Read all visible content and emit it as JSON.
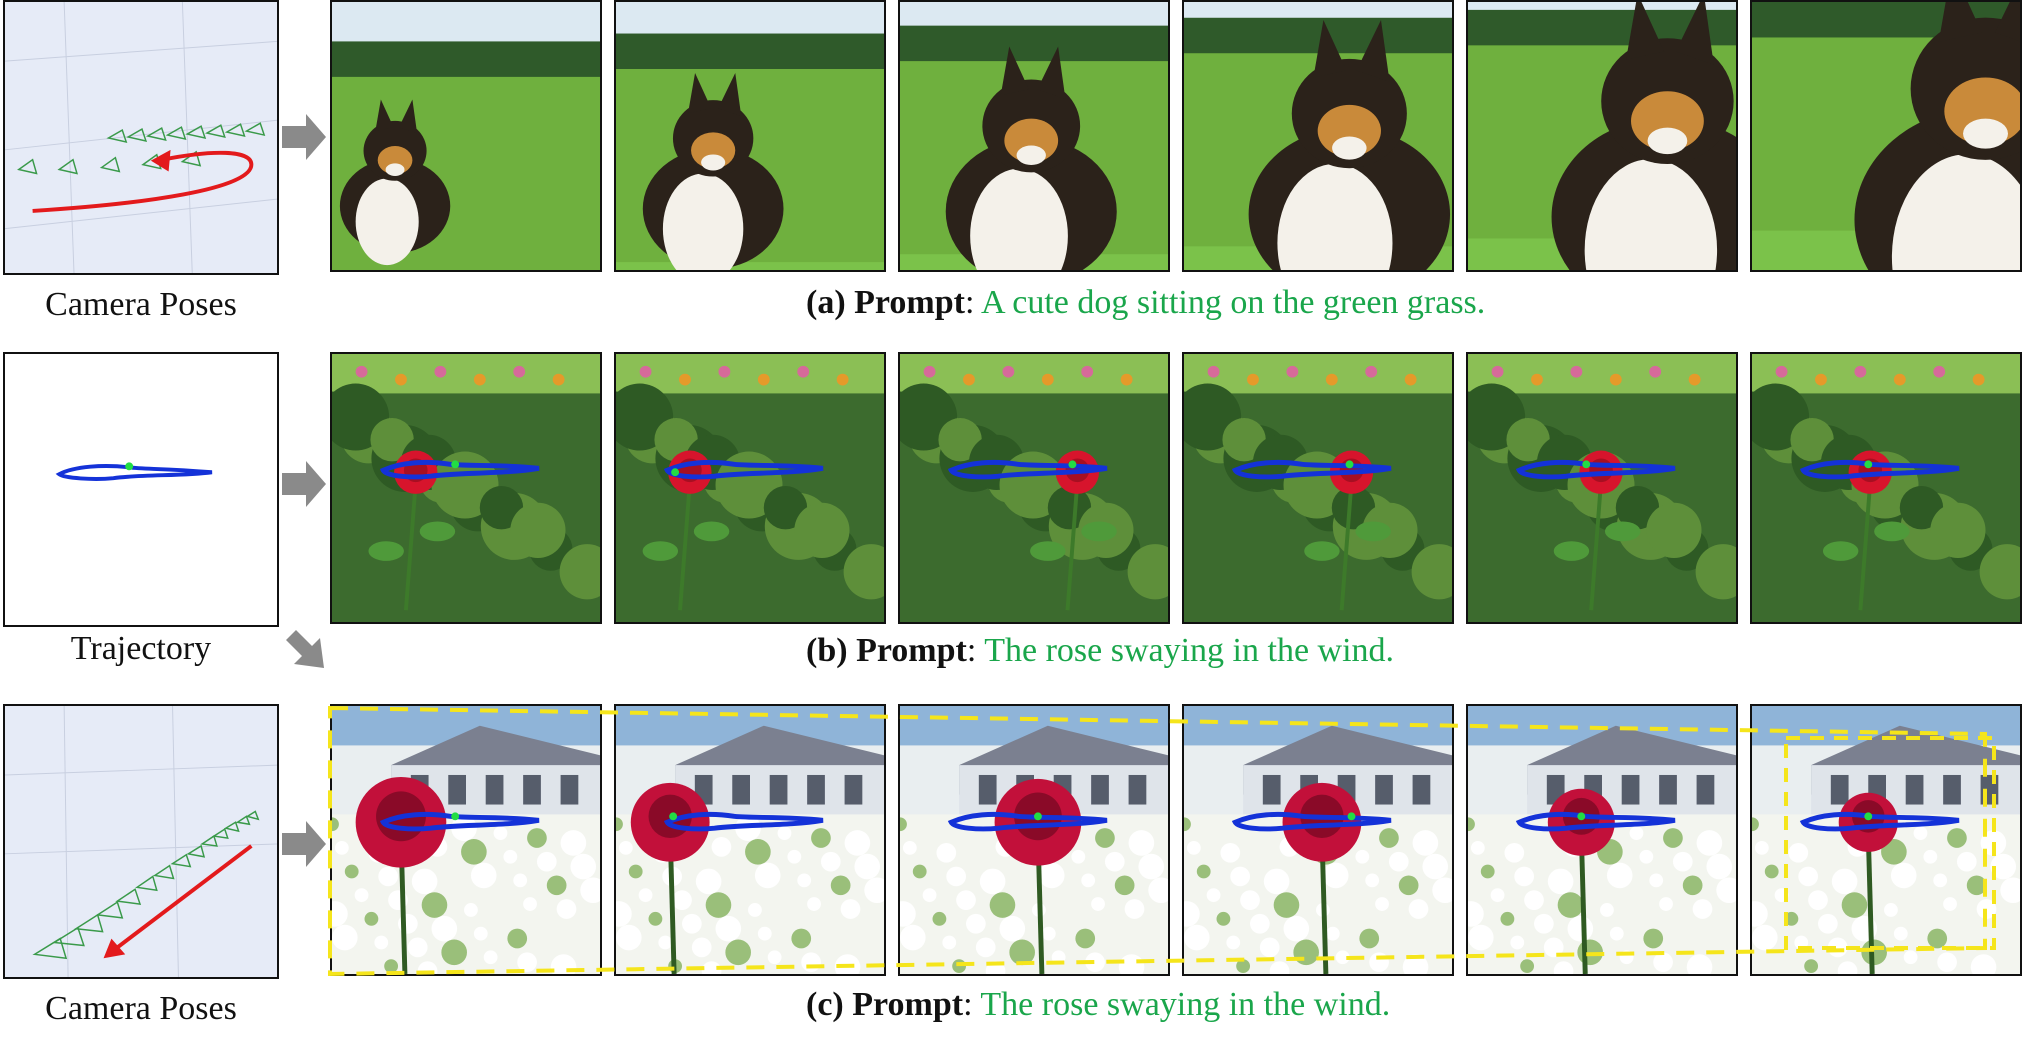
{
  "colors": {
    "prompt_text": "#1aa64b",
    "camera_path": "#e31a1c",
    "trajectory": "#1432d8",
    "track_point": "#22dd44",
    "bbox": "#f5e51b",
    "pose_bg": "#e6ebf7"
  },
  "icons": {
    "process_arrow": "right-arrow-icon",
    "camera_frustum": "camera-frustum-icon"
  },
  "rows": {
    "a": {
      "side_label": "Camera Poses",
      "caption_letter": "(a)",
      "caption_keyword": "Prompt",
      "caption_sep": ":",
      "caption_text": "A cute dog sitting on the green grass.",
      "frames": [
        "frame 1",
        "frame 2",
        "frame 3",
        "frame 4",
        "frame 5",
        "frame 6"
      ]
    },
    "b": {
      "side_label": "Trajectory",
      "caption_letter": "(b)",
      "caption_keyword": "Prompt",
      "caption_sep": ":",
      "caption_text": "The rose swaying in the wind.",
      "frames": [
        "frame 1",
        "frame 2",
        "frame 3",
        "frame 4",
        "frame 5",
        "frame 6"
      ]
    },
    "c": {
      "side_label": "Camera Poses",
      "caption_letter": "(c)",
      "caption_keyword": "Prompt",
      "caption_sep": ":",
      "caption_text": "The rose swaying in the wind.",
      "frames": [
        "frame 1",
        "frame 2",
        "frame 3",
        "frame 4",
        "frame 5",
        "frame 6"
      ]
    }
  }
}
